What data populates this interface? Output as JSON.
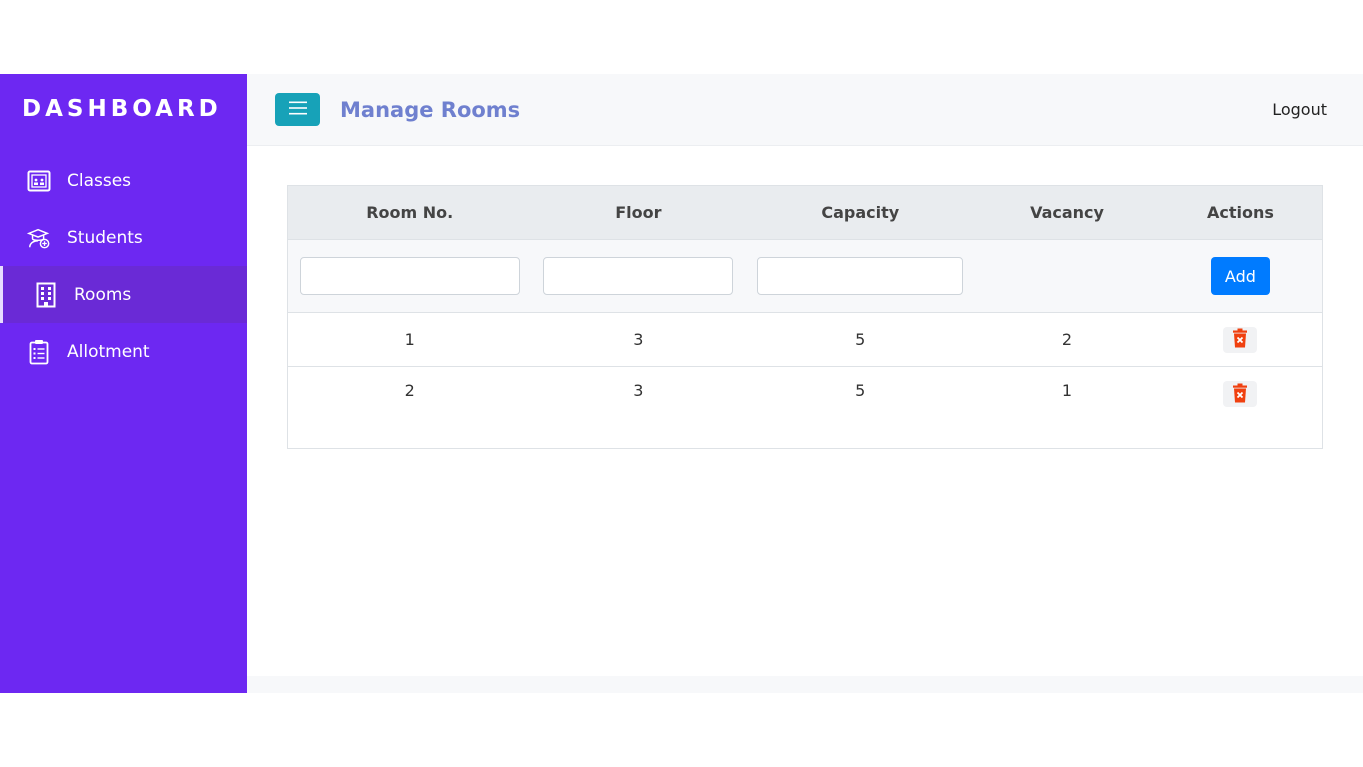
{
  "sidebar": {
    "brand": "DASHBOARD",
    "items": [
      {
        "label": "Classes",
        "icon": "class-board-icon",
        "active": false
      },
      {
        "label": "Students",
        "icon": "graduate-icon",
        "active": false
      },
      {
        "label": "Rooms",
        "icon": "building-icon",
        "active": true
      },
      {
        "label": "Allotment",
        "icon": "clipboard-icon",
        "active": false
      }
    ]
  },
  "header": {
    "title": "Manage Rooms",
    "logout_label": "Logout",
    "menu_icon": "hamburger-icon"
  },
  "table": {
    "columns": [
      "Room No.",
      "Floor",
      "Capacity",
      "Vacancy",
      "Actions"
    ],
    "form": {
      "room_no_value": "",
      "floor_value": "",
      "capacity_value": "",
      "add_label": "Add"
    },
    "rows": [
      {
        "room_no": "1",
        "floor": "3",
        "capacity": "5",
        "vacancy": "2"
      },
      {
        "room_no": "2",
        "floor": "3",
        "capacity": "5",
        "vacancy": "1"
      }
    ],
    "delete_icon": "trash-delete-icon"
  },
  "colors": {
    "sidebar_bg": "#6d28f2",
    "active_item_bg": "#6a2ad6",
    "toggle_button": "#17a2b8",
    "title": "#6f80cf",
    "add_button": "#007bff",
    "delete_icon": "#f0400f"
  }
}
